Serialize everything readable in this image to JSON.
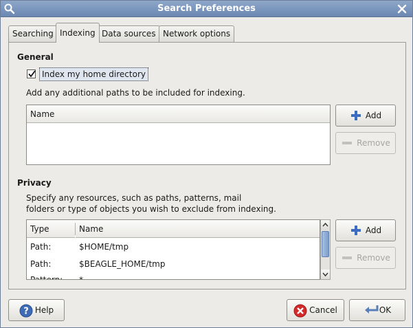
{
  "window": {
    "title": "Search Preferences"
  },
  "tabs": [
    {
      "label": "Searching"
    },
    {
      "label": "Indexing"
    },
    {
      "label": "Data sources"
    },
    {
      "label": "Network options"
    }
  ],
  "general": {
    "heading": "General",
    "checkbox_label": "Index my home directory",
    "checkbox_checked": true,
    "paths_hint": "Add any additional paths to be included for indexing.",
    "list_header": "Name",
    "add_label": "Add",
    "remove_label": "Remove"
  },
  "privacy": {
    "heading": "Privacy",
    "hint_line1": "Specify any resources, such as paths, patterns, mail",
    "hint_line2": "folders or type of objects you wish to exclude from indexing.",
    "col_type": "Type",
    "col_name": "Name",
    "rows": [
      {
        "type": "Path:",
        "name": "$HOME/tmp"
      },
      {
        "type": "Path:",
        "name": "$BEAGLE_HOME/tmp"
      },
      {
        "type": "Pattern:",
        "name": "*"
      }
    ],
    "add_label": "Add",
    "remove_label": "Remove"
  },
  "footer": {
    "help_label": "Help",
    "cancel_label": "Cancel",
    "ok_label": "OK"
  },
  "colors": {
    "titlebar": "#7b96bf",
    "cancel_red": "#d42a2a",
    "add_blue": "#3b6cc2"
  },
  "icons": {
    "title": "search-icon",
    "close": "close-icon",
    "add": "plus-icon",
    "remove": "minus-icon",
    "help": "help-icon",
    "cancel": "cancel-icon",
    "ok": "ok-icon"
  }
}
